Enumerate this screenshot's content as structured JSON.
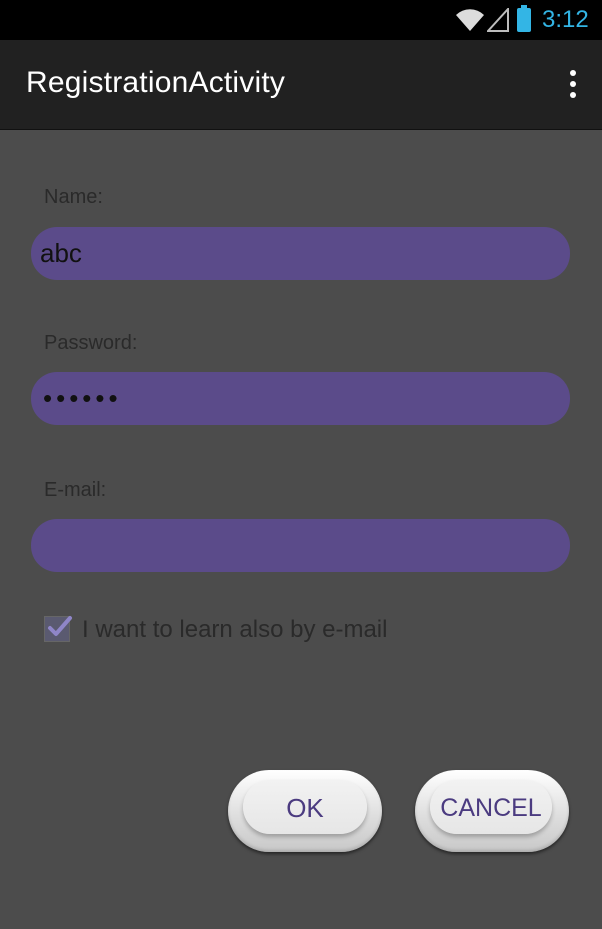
{
  "status_bar": {
    "time": "3:12",
    "icons": [
      "wifi-icon",
      "cell-signal-icon",
      "battery-icon"
    ]
  },
  "action_bar": {
    "title": "RegistrationActivity",
    "overflow_icon": "overflow-menu-icon"
  },
  "form": {
    "name_label": "Name:",
    "name_value": "abc",
    "password_label": "Password:",
    "password_value": "••••••",
    "email_label": "E-mail:",
    "email_value": "",
    "checkbox_label": "I want to learn also by e-mail",
    "checkbox_checked": true
  },
  "buttons": {
    "ok_label": "OK",
    "cancel_label": "CANCEL"
  },
  "colors": {
    "status_accent": "#33b5e5",
    "field_fill": "#5b4b8a",
    "button_text": "#4b3b80",
    "background": "#4c4c4c"
  }
}
